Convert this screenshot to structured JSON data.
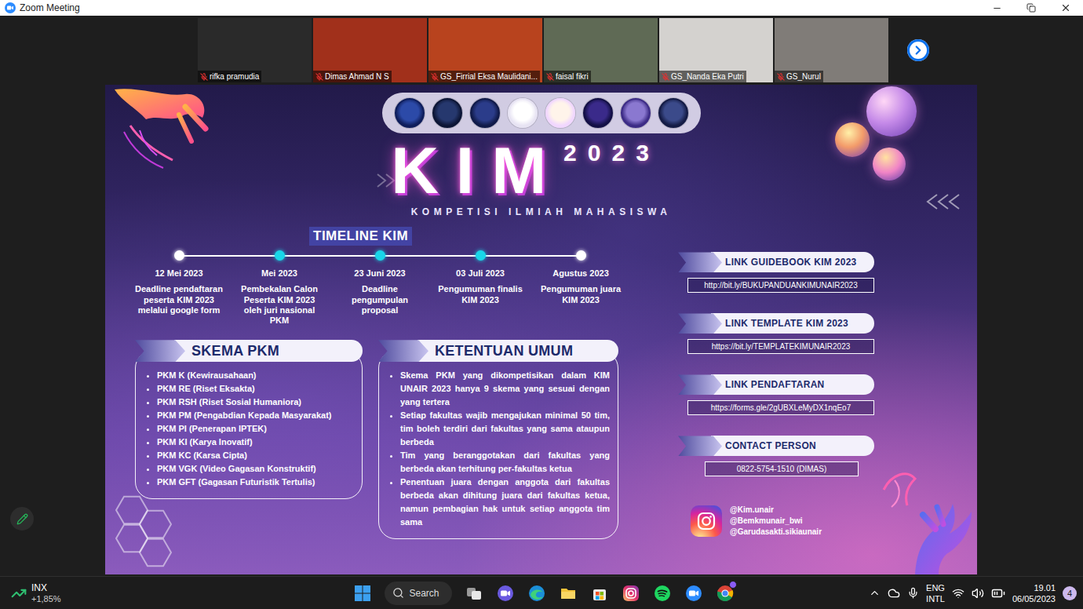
{
  "window": {
    "title": "Zoom Meeting"
  },
  "participants": [
    {
      "name": "rifka pramudia",
      "muted": true
    },
    {
      "name": "Dimas Ahmad N S",
      "muted": true
    },
    {
      "name": "GS_Firrial Eksa Maulidani...",
      "muted": true
    },
    {
      "name": "faisal fikri",
      "muted": true
    },
    {
      "name": "GS_Nanda Eka Putri",
      "muted": true
    },
    {
      "name": "GS_Nurul",
      "muted": true
    }
  ],
  "slide": {
    "title": "KIM",
    "year": "2023",
    "subtitle": "KOMPETISI ILMIAH MAHASISWA",
    "timeline": {
      "heading": "TIMELINE KIM",
      "items": [
        {
          "date": "12 Mei 2023",
          "text": "Deadline pendaftaran peserta KIM 2023 melalui google form",
          "color": "#ffffff"
        },
        {
          "date": "Mei 2023",
          "text": "Pembekalan Calon Peserta KIM 2023 oleh juri nasional PKM",
          "color": "#19d6e8"
        },
        {
          "date": "23 Juni 2023",
          "text": "Deadline pengumpulan proposal",
          "color": "#19d6e8"
        },
        {
          "date": "03 Juli 2023",
          "text": "Pengumuman finalis KIM 2023",
          "color": "#19d6e8"
        },
        {
          "date": "Agustus 2023",
          "text": "Pengumuman juara KIM 2023",
          "color": "#ffffff"
        }
      ]
    },
    "skema": {
      "heading": "SKEMA PKM",
      "items": [
        "PKM K (Kewirausahaan)",
        "PKM RE (Riset Eksakta)",
        "PKM RSH (Riset Sosial Humaniora)",
        "PKM PM (Pengabdian Kepada Masyarakat)",
        "PKM PI (Penerapan IPTEK)",
        "PKM KI (Karya Inovatif)",
        "PKM KC (Karsa Cipta)",
        "PKM VGK (Video Gagasan Konstruktif)",
        "PKM GFT (Gagasan Futuristik Tertulis)"
      ]
    },
    "ketentuan": {
      "heading": "KETENTUAN UMUM",
      "items": [
        "Skema PKM yang dikompetisikan dalam KIM UNAIR 2023 hanya 9 skema yang sesuai dengan yang tertera",
        "Setiap fakultas wajib mengajukan minimal 50 tim, tim boleh terdiri dari fakultas yang sama ataupun berbeda",
        "Tim yang beranggotakan dari fakultas yang berbeda akan terhitung per-fakultas ketua",
        "Penentuan juara dengan anggota dari fakultas berbeda akan dihitung juara dari fakultas ketua, namun pembagian hak untuk setiap anggota tim sama"
      ]
    },
    "links": [
      {
        "label": "LINK GUIDEBOOK KIM 2023",
        "value": "http://bit.ly/BUKUPANDUANKIMUNAIR2023"
      },
      {
        "label": "LINK TEMPLATE KIM 2023",
        "value": "https://bit.ly/TEMPLATEKIMUNAIR2023"
      },
      {
        "label": "LINK PENDAFTARAN",
        "value": "https://forms.gle/2gUBXLeMyDX1nqEo7"
      },
      {
        "label": "CONTACT PERSON",
        "value": "0822-5754-1510 (DIMAS)"
      }
    ],
    "socials": [
      "@Kim.unair",
      "@Bemkmunair_bwi",
      "@Garudasakti.sikiaunair"
    ]
  },
  "taskbar": {
    "stock": {
      "symbol": "INX",
      "change": "+1,85%"
    },
    "search": {
      "placeholder": "Search"
    },
    "language": {
      "code": "ENG",
      "layout": "INTL"
    },
    "clock": {
      "time": "19.01",
      "date": "06/05/2023"
    },
    "notifications": "4"
  }
}
